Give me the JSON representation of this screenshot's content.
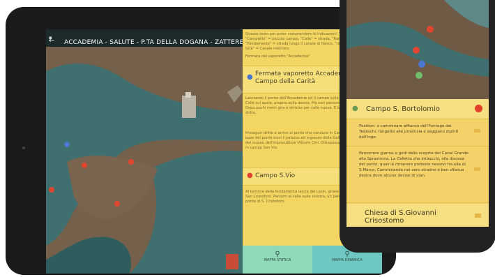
{
  "tablet": {
    "status_icon": "▪",
    "back_icon": "←",
    "title": "ACCADEMIA - SALUTE - P.TA DELLA DOGANA - ZATTERE",
    "panel": {
      "intro_text": "Questo testo per poter comprendere le indicazioni: \"Campo\" = Piazza, \"Campiello\" = piccolo campo, \"Calle\" = strada, \"Ramo\" = breve calle, \"Fondamenta\" = strada lungo il canale di fianco, \"rio\" = canale, \"rio terà\" = Canale interrato",
      "subheading": "Fermata del vaporetto \"Accademia\"",
      "stop1": "Fermata vaporetto Accademia/ Campo della Carità",
      "body1": "Lasciando il ponte dell'Accademia ed il campo sulla vostra sinistra. Calle sul quale, proprio sulla destra. Ma non percorrete il Traghetto. Dopo pochi metri gira a sinistra per calle nuova. E tagliate e proseguire dritto.",
      "body2": "Proseguir dritto e arrivo al ponte che conduce in Campo San Vio. Alla base del ponte trovi il palazzo ed ingresso della Galleria di Palazzo Cini, del museo dell'imprenditore Vittorio Cini. Oltrepassa il ponte, sei giunti in campo San Vio.",
      "stop2": "Campo S.Vio",
      "body3": "Al termine della fondamenta lascia dei Lesin, girare a sinistra per calle San Cristoforo. Percorri la calle sulla sinistra, un percorso abbigliato, al ponte di S. Cristoforo.",
      "tabs": [
        {
          "label": "MAPPA STATICA"
        },
        {
          "label": "MAPPA DINAMICA"
        }
      ]
    }
  },
  "phone": {
    "list": {
      "header": "Campo S. Bortolomio",
      "items": [
        {
          "text": "Position: a camminare affianco dell'Fontego dei Tedeschi, fungette alle provincia e seggiano dipinti dell'ingo."
        },
        {
          "text": "Percorrere gianne e godi delle scoprte del Canal Grande alla Sprastrona. La Calletta che imbocchi, alla discesa del ponto, quasi è rimanere proteste nesono tra ella di S.Marco, Camminando nel vero stradno e ben sfilatua destra dove alcune decise di vian."
        }
      ],
      "last_header": "Chiesa di S.Giovanni Crisostomo"
    }
  },
  "colors": {
    "panel_yellow": "#f2d562",
    "water": "#3f6f6f",
    "tab_green": "#8fd9b8",
    "tab_teal": "#6ec7c0",
    "pin_red": "#e0462f",
    "pin_blue": "#4a78d0"
  }
}
